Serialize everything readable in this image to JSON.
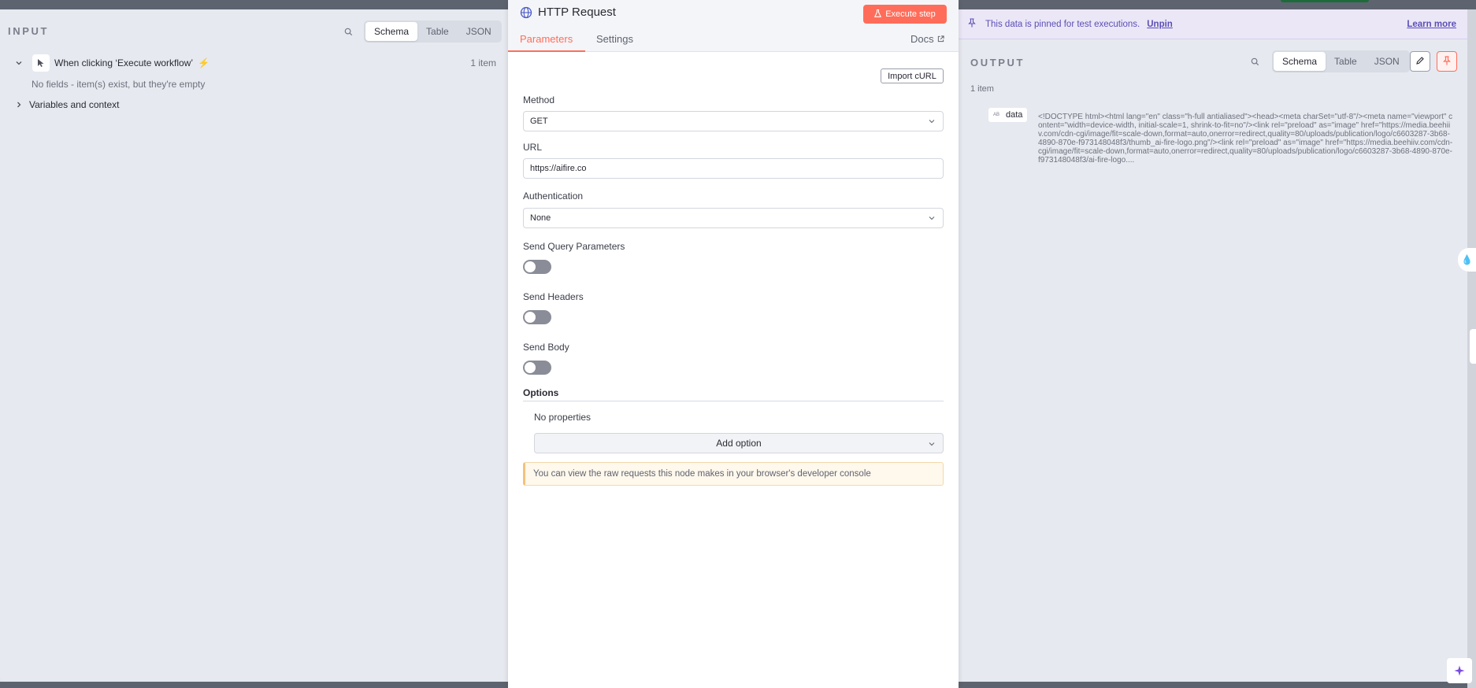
{
  "input": {
    "title": "INPUT",
    "tabs": [
      "Schema",
      "Table",
      "JSON"
    ],
    "trigger_label": "When clicking ‘Execute workflow’",
    "item_count": "1 item",
    "empty_message": "No fields - item(s) exist, but they're empty",
    "variables_label": "Variables and context"
  },
  "node": {
    "title": "HTTP Request",
    "execute_label": "Execute step",
    "tabs": [
      "Parameters",
      "Settings"
    ],
    "docs_label": "Docs",
    "import_curl_label": "Import cURL",
    "method_label": "Method",
    "method_value": "GET",
    "url_label": "URL",
    "url_value": "https://aifire.co",
    "auth_label": "Authentication",
    "auth_value": "None",
    "send_query_label": "Send Query Parameters",
    "send_headers_label": "Send Headers",
    "send_body_label": "Send Body",
    "options_label": "Options",
    "no_properties": "No properties",
    "add_option_label": "Add option",
    "notice": "You can view the raw requests this node makes in your browser's developer console"
  },
  "output": {
    "pin_message": "This data is pinned for test executions.",
    "unpin_label": "Unpin",
    "learn_more_label": "Learn more",
    "title": "OUTPUT",
    "tabs": [
      "Schema",
      "Table",
      "JSON"
    ],
    "item_count": "1 item",
    "field_type": "AB",
    "field_name": "data",
    "field_value": "<!DOCTYPE html><html lang=\"en\" class=\"h-full antialiased\"><head><meta charSet=\"utf-8\"/><meta name=\"viewport\" content=\"width=device-width, initial-scale=1, shrink-to-fit=no\"/><link rel=\"preload\" as=\"image\" href=\"https://media.beehiiv.com/cdn-cgi/image/fit=scale-down,format=auto,onerror=redirect,quality=80/uploads/publication/logo/c6603287-3b68-4890-870e-f973148048f3/thumb_ai-fire-logo.png\"/><link rel=\"preload\" as=\"image\" href=\"https://media.beehiiv.com/cdn-cgi/image/fit=scale-down,format=auto,onerror=redirect,quality=80/uploads/publication/logo/c6603287-3b68-4890-870e-f973148048f3/ai-fire-logo...."
  },
  "colors": {
    "accent": "#ff6d5a",
    "pin_banner_bg": "#ebe7f7",
    "pin_text": "#5b4fb5"
  },
  "icons": {
    "node": "globe-icon",
    "trigger": "cursor-icon",
    "execute": "flask-icon",
    "docs": "external-link-icon",
    "edit": "pencil-icon",
    "pin": "pin-icon",
    "ai": "sparkle-icon"
  }
}
